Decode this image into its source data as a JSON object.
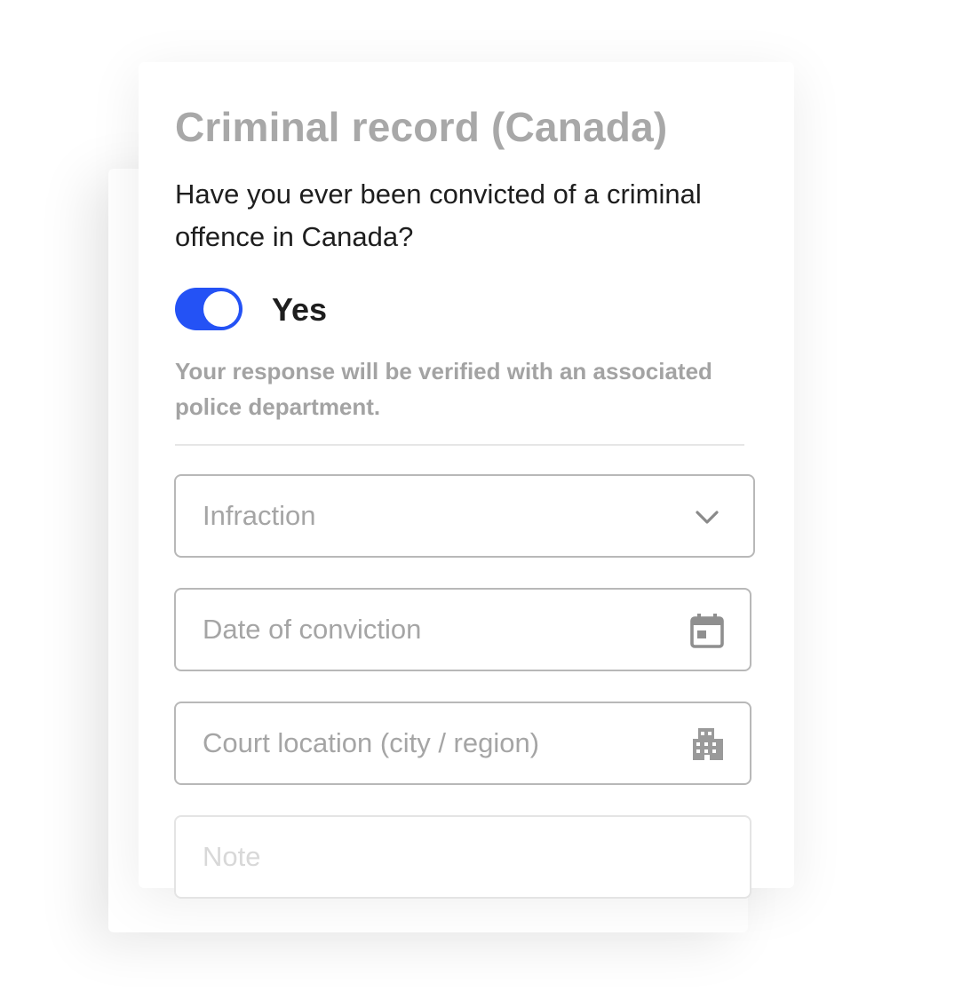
{
  "form": {
    "title": "Criminal record (Canada)",
    "question": "Have you ever been convicted of a criminal offence in Canada?",
    "toggle": {
      "label": "Yes",
      "on": true,
      "accent_color": "#2452f5"
    },
    "help_text": "Your response will be verified with an associated police department.",
    "fields": {
      "infraction": {
        "placeholder": "Infraction",
        "icon": "chevron-down-icon"
      },
      "date": {
        "placeholder": "Date of conviction",
        "icon": "calendar-icon"
      },
      "court": {
        "placeholder": "Court location (city / region)",
        "icon": "building-icon"
      },
      "note": {
        "placeholder": "Note"
      }
    }
  }
}
